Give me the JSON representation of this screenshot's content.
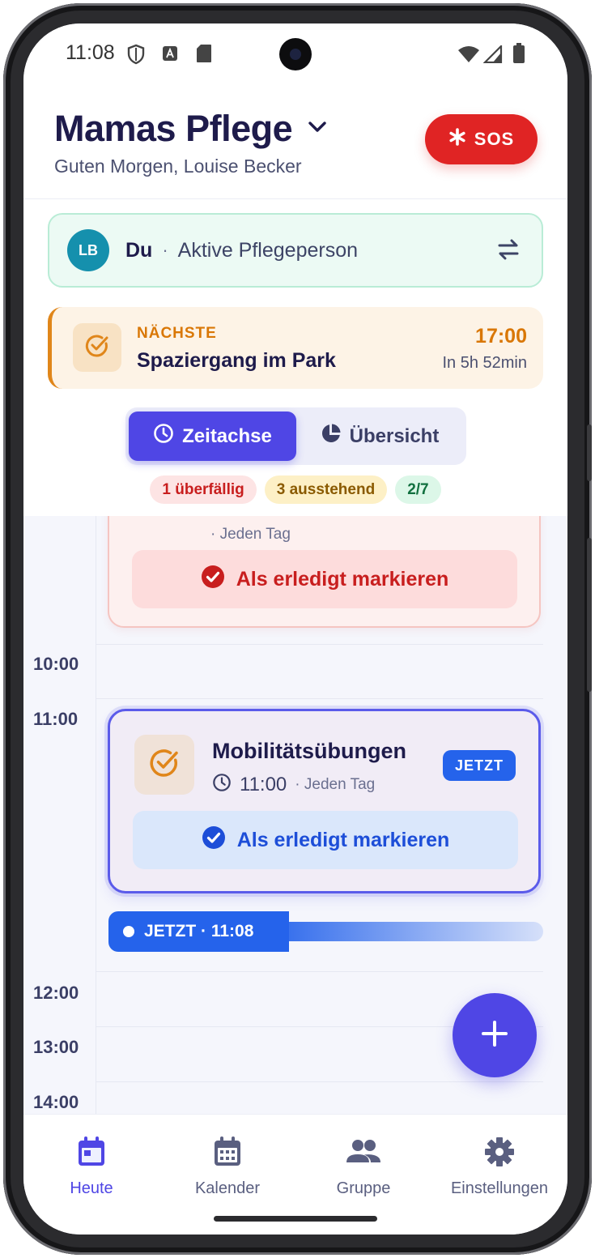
{
  "status_bar": {
    "time": "11:08"
  },
  "header": {
    "title": "Mamas Pflege",
    "greeting": "Guten Morgen, Louise Becker",
    "sos_label": "SOS"
  },
  "caregiver": {
    "initials": "LB",
    "name": "Du",
    "separator": "·",
    "role": "Aktive Pflegeperson"
  },
  "next_task": {
    "label": "NÄCHSTE",
    "title": "Spaziergang im Park",
    "time": "17:00",
    "relative": "In 5h 52min"
  },
  "view_toggle": {
    "timeline_label": "Zeitachse",
    "overview_label": "Übersicht",
    "selected": "Zeitachse"
  },
  "status_badges": {
    "overdue": "1 überfällig",
    "pending": "3 ausstehend",
    "progress": "2/7"
  },
  "timeline": {
    "hours": [
      "10:00",
      "11:00",
      "12:00",
      "13:00",
      "14:00"
    ],
    "overdue_task": {
      "recurrence": "· Jeden Tag",
      "done_label": "Als erledigt markieren"
    },
    "current_task": {
      "title": "Mobilitätsübungen",
      "time": "11:00",
      "recurrence": "· Jeden Tag",
      "badge": "JETZT",
      "done_label": "Als erledigt markieren"
    },
    "now_marker": "JETZT · 11:08"
  },
  "nav": {
    "items": [
      {
        "label": "Heute",
        "icon": "calendar-today-icon",
        "active": true
      },
      {
        "label": "Kalender",
        "icon": "calendar-grid-icon",
        "active": false
      },
      {
        "label": "Gruppe",
        "icon": "group-icon",
        "active": false
      },
      {
        "label": "Einstellungen",
        "icon": "gear-icon",
        "active": false
      }
    ]
  },
  "colors": {
    "accent": "#4f46e5",
    "sos": "#e02424",
    "now_blue": "#2563eb",
    "next_orange": "#d97706"
  }
}
